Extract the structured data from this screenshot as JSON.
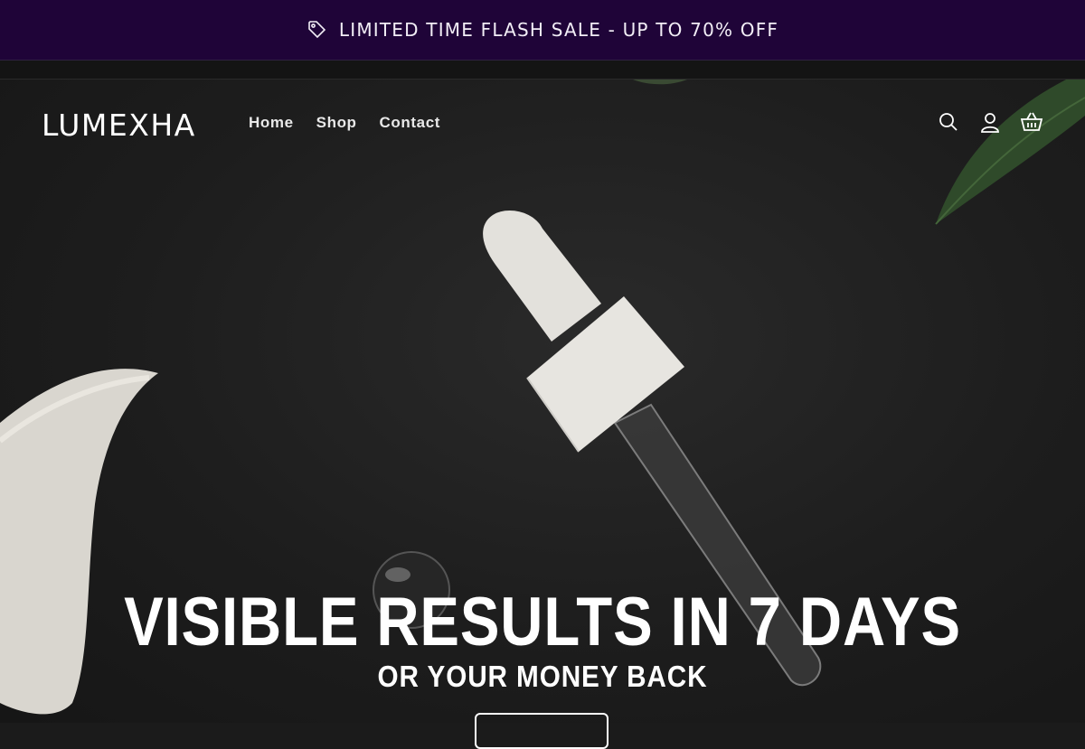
{
  "announcement": {
    "text": "LIMITED TIME FLASH SALE - UP TO 70% OFF",
    "icon": "tag-icon"
  },
  "header": {
    "logo": "LUMEXHA",
    "nav": [
      {
        "label": "Home"
      },
      {
        "label": "Shop"
      },
      {
        "label": "Contact"
      }
    ],
    "icons": [
      "search-icon",
      "account-icon",
      "cart-icon"
    ]
  },
  "hero": {
    "headline": "VISIBLE RESULTS IN 7 DAYS",
    "subheadline": "OR YOUR MONEY BACK",
    "cta_label": ""
  },
  "colors": {
    "announcement_bg": "#1f0438",
    "hero_bg": "#1d1d1d",
    "text": "#ffffff"
  }
}
